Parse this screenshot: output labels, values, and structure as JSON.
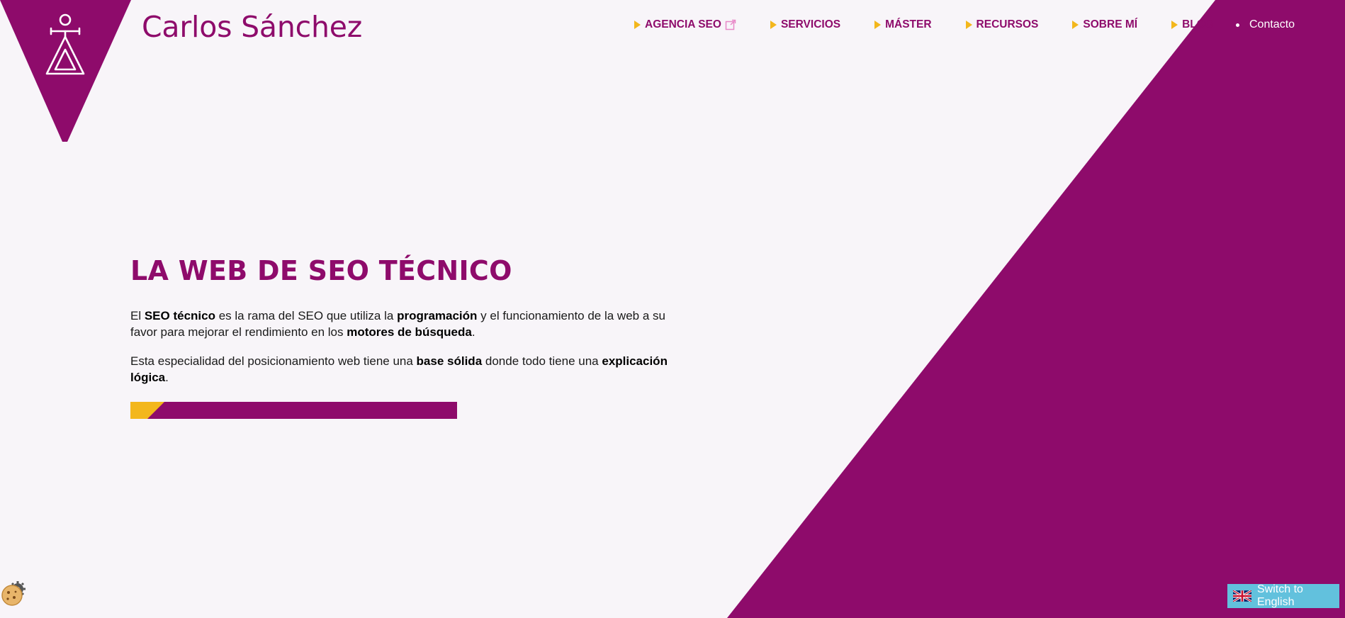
{
  "brand": {
    "name": "Carlos Sánchez"
  },
  "colors": {
    "primary": "#8e0b6b",
    "accent": "#f3b71c",
    "background": "#f8f5f9",
    "lang_button": "#62c1dd"
  },
  "nav": {
    "items": [
      {
        "label": "AGENCIA SEO",
        "external": true
      },
      {
        "label": "SERVICIOS"
      },
      {
        "label": "MÁSTER"
      },
      {
        "label": "RECURSOS"
      },
      {
        "label": "SOBRE MÍ"
      },
      {
        "label": "BLOG"
      }
    ],
    "contact": "Contacto"
  },
  "hero": {
    "title": "LA WEB DE SEO TÉCNICO",
    "p1": {
      "t1": "El ",
      "b1": "SEO técnico",
      "t2": " es la rama del SEO que utiliza la ",
      "b2": "programación",
      "t3": " y el funcionamiento de la web a su favor para mejorar el rendimiento en los ",
      "b3": "motores de búsqueda",
      "t4": "."
    },
    "p2": {
      "t1": "Esta especialidad del posicionamiento web tiene una ",
      "b1": "base sólida",
      "t2": " donde todo tiene una ",
      "b2": "explicación lógica",
      "t3": "."
    }
  },
  "language_switch": {
    "label": "Switch to English",
    "icon": "uk-flag-icon"
  },
  "cookie": {
    "icon": "cookie-gear-icon"
  }
}
